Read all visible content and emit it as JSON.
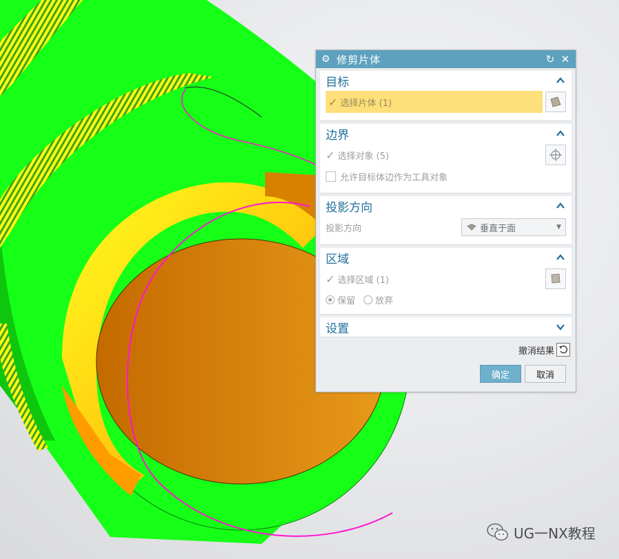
{
  "dialog": {
    "title": "修剪片体",
    "sections": {
      "target": {
        "header": "目标",
        "select_label": "选择片体 (1)"
      },
      "boundary": {
        "header": "边界",
        "select_label": "选择对象 (5)",
        "allow_edge_label": "允许目标体边作为工具对象"
      },
      "projection": {
        "header": "投影方向",
        "field_label": "投影方向",
        "value": "垂直于面"
      },
      "region": {
        "header": "区域",
        "select_label": "选择区域 (1)",
        "keep_label": "保留",
        "discard_label": "放弃",
        "selected_option": "保留"
      },
      "settings": {
        "header": "设置"
      }
    },
    "undo_label": "撤消结果",
    "ok_label": "确定",
    "cancel_label": "取消"
  },
  "watermark": {
    "text": "UG一NX教程"
  },
  "colors": {
    "title_bg": "#5ea1bf",
    "section_header": "#1f6f9b",
    "target_highlight": "#fde07a",
    "model_green": "#16ff16",
    "model_yellow": "#ffff10",
    "model_orange": "#d88000",
    "curve_magenta": "#ff14d0"
  }
}
